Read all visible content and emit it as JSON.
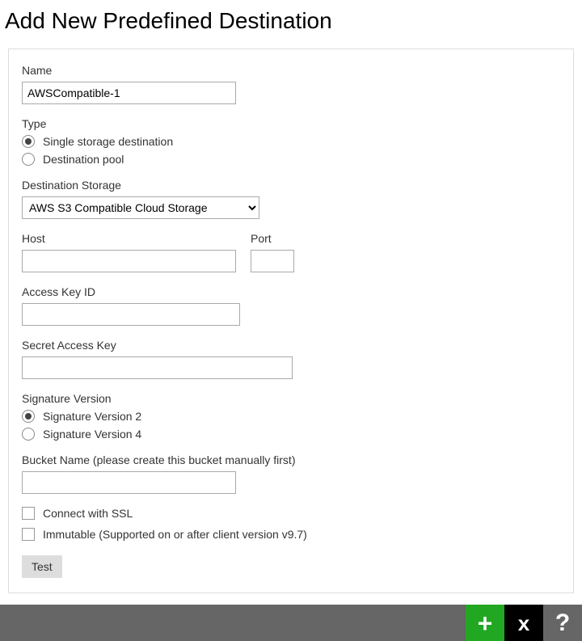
{
  "title": "Add New Predefined Destination",
  "fields": {
    "name": {
      "label": "Name",
      "value": "AWSCompatible-1"
    },
    "type": {
      "label": "Type",
      "options": {
        "single": "Single storage destination",
        "pool": "Destination pool"
      },
      "selected": "single"
    },
    "destination_storage": {
      "label": "Destination Storage",
      "value": "AWS S3 Compatible Cloud Storage"
    },
    "host": {
      "label": "Host",
      "value": ""
    },
    "port": {
      "label": "Port",
      "value": ""
    },
    "access_key": {
      "label": "Access Key ID",
      "value": ""
    },
    "secret_key": {
      "label": "Secret Access Key",
      "value": ""
    },
    "signature": {
      "label": "Signature Version",
      "options": {
        "v2": "Signature Version 2",
        "v4": "Signature Version 4"
      },
      "selected": "v2"
    },
    "bucket": {
      "label": "Bucket Name (please create this bucket manually first)",
      "value": ""
    },
    "ssl": {
      "label": "Connect with SSL",
      "checked": false
    },
    "immutable": {
      "label": "Immutable (Supported on or after client version v9.7)",
      "checked": false
    }
  },
  "buttons": {
    "test": "Test"
  },
  "footer": {
    "add": "+",
    "close": "x",
    "help": "?"
  }
}
